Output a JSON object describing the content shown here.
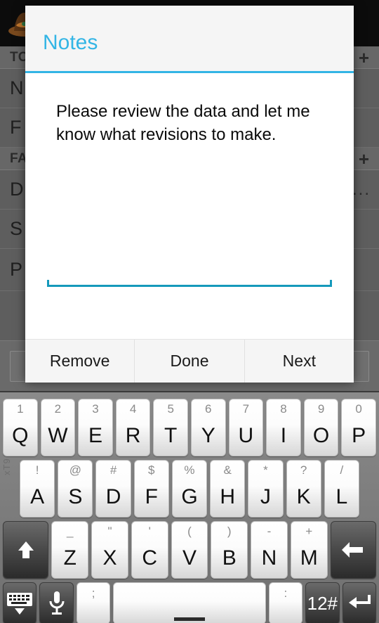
{
  "background_app": {
    "actionbar": {
      "logo_icon": "cowboy-hat-logo"
    },
    "sections": [
      {
        "label": "TO",
        "add_icon": "plus-icon"
      },
      {
        "label": "FA",
        "add_icon": "plus-icon"
      }
    ],
    "rows": [
      {
        "label": "N",
        "extra": ""
      },
      {
        "label": "F",
        "extra": ""
      },
      {
        "label": "D",
        "extra": "..."
      },
      {
        "label": "S",
        "extra": ""
      },
      {
        "label": "P",
        "extra": ""
      }
    ],
    "footer_field_placeholder": ""
  },
  "dialog": {
    "title": "Notes",
    "message": "Please review the data and let me know what revisions to make.",
    "input_value": "",
    "buttons": [
      {
        "label": "Remove",
        "name": "remove-button"
      },
      {
        "label": "Done",
        "name": "done-button"
      },
      {
        "label": "Next",
        "name": "next-button"
      }
    ],
    "accent_color": "#33b5e5"
  },
  "keyboard": {
    "mode": "qwerty-uppercase",
    "rows": [
      [
        {
          "main": "Q",
          "hint": "1"
        },
        {
          "main": "W",
          "hint": "2"
        },
        {
          "main": "E",
          "hint": "3"
        },
        {
          "main": "R",
          "hint": "4"
        },
        {
          "main": "T",
          "hint": "5"
        },
        {
          "main": "Y",
          "hint": "6"
        },
        {
          "main": "U",
          "hint": "7"
        },
        {
          "main": "I",
          "hint": "8"
        },
        {
          "main": "O",
          "hint": "9"
        },
        {
          "main": "P",
          "hint": "0"
        }
      ],
      [
        {
          "main": "A",
          "hint": "!"
        },
        {
          "main": "S",
          "hint": "@"
        },
        {
          "main": "D",
          "hint": "#"
        },
        {
          "main": "F",
          "hint": "$"
        },
        {
          "main": "G",
          "hint": "%"
        },
        {
          "main": "H",
          "hint": "&"
        },
        {
          "main": "J",
          "hint": "*"
        },
        {
          "main": "K",
          "hint": "?"
        },
        {
          "main": "L",
          "hint": "/"
        }
      ],
      [
        {
          "main": "Z",
          "hint": "_"
        },
        {
          "main": "X",
          "hint": "\""
        },
        {
          "main": "C",
          "hint": "'"
        },
        {
          "main": "V",
          "hint": "("
        },
        {
          "main": "B",
          "hint": ")"
        },
        {
          "main": "N",
          "hint": "-"
        },
        {
          "main": "M",
          "hint": "+"
        }
      ]
    ],
    "shift_icon": "shift-up-arrow-icon",
    "backspace_icon": "backspace-left-arrow-icon",
    "hide_keyboard_icon": "hide-keyboard-icon",
    "mic_icon": "microphone-icon",
    "comma_hint": ";",
    "period_hint": ":",
    "space_label": "",
    "symbols_label": "12#",
    "enter_icon": "enter-return-icon",
    "xt9_label": "xT9"
  }
}
